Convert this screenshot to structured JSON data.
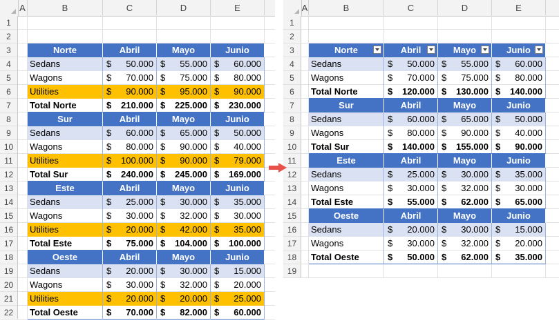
{
  "left": {
    "columns": [
      "A",
      "B",
      "C",
      "D",
      "E"
    ],
    "rows": [
      "1",
      "2",
      "3",
      "4",
      "5",
      "6",
      "7",
      "8",
      "9",
      "10",
      "11",
      "12",
      "13",
      "14",
      "15",
      "16",
      "17",
      "18",
      "19",
      "20",
      "21",
      "22"
    ],
    "currency": "$",
    "header_months": [
      "Abril",
      "Mayo",
      "Junio"
    ],
    "blocks": [
      {
        "region": "Norte",
        "items": [
          {
            "label": "Sedans",
            "values": [
              "50.000",
              "55.000",
              "60.000"
            ]
          },
          {
            "label": "Wagons",
            "values": [
              "70.000",
              "75.000",
              "80.000"
            ]
          },
          {
            "label": "Utilities",
            "values": [
              "90.000",
              "95.000",
              "90.000"
            ]
          }
        ],
        "total": {
          "label": "Total Norte",
          "values": [
            "210.000",
            "225.000",
            "230.000"
          ]
        }
      },
      {
        "region": "Sur",
        "items": [
          {
            "label": "Sedans",
            "values": [
              "60.000",
              "65.000",
              "50.000"
            ]
          },
          {
            "label": "Wagons",
            "values": [
              "80.000",
              "90.000",
              "40.000"
            ]
          },
          {
            "label": "Utilities",
            "values": [
              "100.000",
              "90.000",
              "79.000"
            ]
          }
        ],
        "total": {
          "label": "Total Sur",
          "values": [
            "240.000",
            "245.000",
            "169.000"
          ]
        }
      },
      {
        "region": "Este",
        "items": [
          {
            "label": "Sedans",
            "values": [
              "25.000",
              "30.000",
              "35.000"
            ]
          },
          {
            "label": "Wagons",
            "values": [
              "30.000",
              "32.000",
              "30.000"
            ]
          },
          {
            "label": "Utilities",
            "values": [
              "20.000",
              "42.000",
              "35.000"
            ]
          }
        ],
        "total": {
          "label": "Total Este",
          "values": [
            "75.000",
            "104.000",
            "100.000"
          ]
        }
      },
      {
        "region": "Oeste",
        "items": [
          {
            "label": "Sedans",
            "values": [
              "20.000",
              "30.000",
              "15.000"
            ]
          },
          {
            "label": "Wagons",
            "values": [
              "30.000",
              "32.000",
              "20.000"
            ]
          },
          {
            "label": "Utilities",
            "values": [
              "20.000",
              "20.000",
              "25.000"
            ]
          }
        ],
        "total": {
          "label": "Total Oeste",
          "values": [
            "70.000",
            "82.000",
            "60.000"
          ]
        }
      }
    ]
  },
  "right": {
    "columns": [
      "A",
      "B",
      "C",
      "D",
      "E"
    ],
    "rows": [
      "1",
      "2",
      "3",
      "4",
      "5",
      "6",
      "7",
      "8",
      "9",
      "10",
      "11",
      "12",
      "13",
      "14",
      "15",
      "16",
      "17",
      "18",
      "19"
    ],
    "currency": "$",
    "header_months": [
      "Abril",
      "Mayo",
      "Junio"
    ],
    "blocks": [
      {
        "region": "Norte",
        "items": [
          {
            "label": "Sedans",
            "values": [
              "50.000",
              "55.000",
              "60.000"
            ]
          },
          {
            "label": "Wagons",
            "values": [
              "70.000",
              "75.000",
              "80.000"
            ]
          }
        ],
        "total": {
          "label": "Total Norte",
          "values": [
            "120.000",
            "130.000",
            "140.000"
          ]
        }
      },
      {
        "region": "Sur",
        "items": [
          {
            "label": "Sedans",
            "values": [
              "60.000",
              "65.000",
              "50.000"
            ]
          },
          {
            "label": "Wagons",
            "values": [
              "80.000",
              "90.000",
              "40.000"
            ]
          }
        ],
        "total": {
          "label": "Total Sur",
          "values": [
            "140.000",
            "155.000",
            "90.000"
          ]
        }
      },
      {
        "region": "Este",
        "items": [
          {
            "label": "Sedans",
            "values": [
              "25.000",
              "30.000",
              "35.000"
            ]
          },
          {
            "label": "Wagons",
            "values": [
              "30.000",
              "32.000",
              "30.000"
            ]
          }
        ],
        "total": {
          "label": "Total Este",
          "values": [
            "55.000",
            "62.000",
            "65.000"
          ]
        }
      },
      {
        "region": "Oeste",
        "items": [
          {
            "label": "Sedans",
            "values": [
              "20.000",
              "30.000",
              "15.000"
            ]
          },
          {
            "label": "Wagons",
            "values": [
              "30.000",
              "32.000",
              "20.000"
            ]
          }
        ],
        "total": {
          "label": "Total Oeste",
          "values": [
            "50.000",
            "62.000",
            "35.000"
          ]
        }
      }
    ]
  },
  "colors": {
    "header_fill": "#4472c4",
    "band_fill": "#d9e1f2",
    "utilities_fill": "#ffc000",
    "arrow": "#e8504a"
  },
  "icons": {
    "arrow": "right-arrow-icon",
    "filter": "filter-dropdown-icon"
  }
}
